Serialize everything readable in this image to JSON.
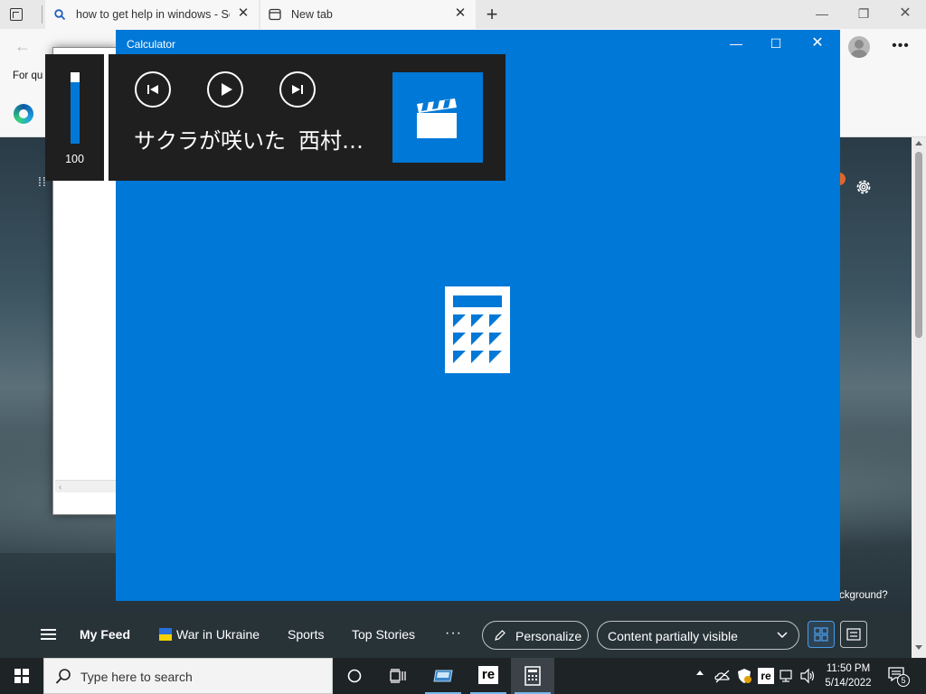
{
  "browser": {
    "tabs": [
      {
        "title": "how to get help in windows - Se",
        "icon": "search-icon"
      },
      {
        "title": "New tab",
        "icon": "newtab-icon"
      }
    ],
    "favorites_text": "For qu"
  },
  "newtab": {
    "background_link_text": "ckground?",
    "feed_nav": {
      "items": [
        "My Feed",
        "War in Ukraine",
        "Sports",
        "Top Stories"
      ],
      "more": "···",
      "personalize": "Personalize",
      "content_visibility": "Content partially visible"
    }
  },
  "calculator": {
    "title": "Calculator",
    "accent_color": "#0078d7"
  },
  "media_overlay": {
    "volume": "100",
    "volume_level": 0.86,
    "track_title": "サクラが咲いた",
    "artist": "西村…"
  },
  "taskbar": {
    "search_placeholder": "Type here to search",
    "time": "11:50 PM",
    "date": "5/14/2022",
    "notification_count": "5"
  }
}
